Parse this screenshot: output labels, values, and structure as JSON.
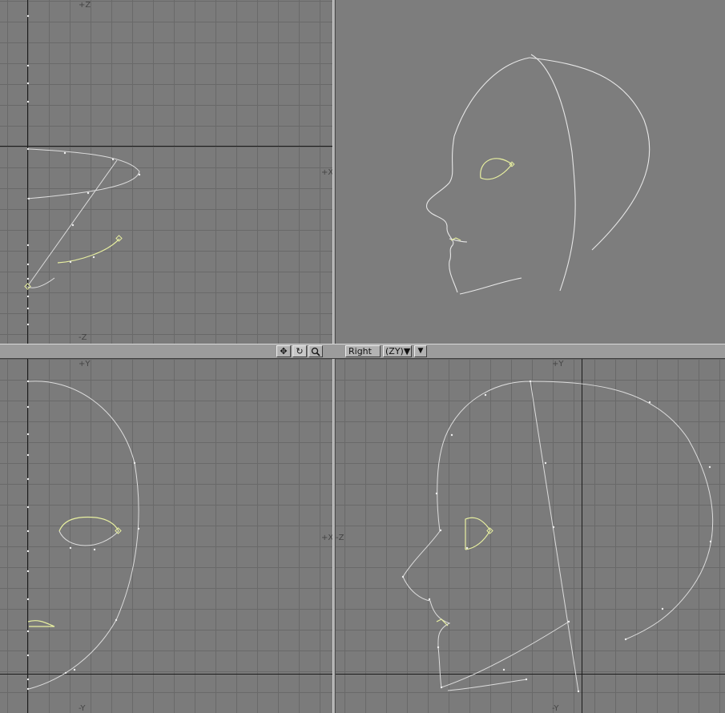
{
  "colors": {
    "curve": "#d8d8d8",
    "selected": "#e8f0a0",
    "viewport_bg": "#7b7b7b",
    "grid": "#696969",
    "axis": "#1c1c1c"
  },
  "viewports": {
    "top_left": {
      "label_top": "+Z",
      "label_right": "+X",
      "label_bottom": "-Z"
    },
    "top_right": {
      "mode": "perspective"
    },
    "bottom_left": {
      "label_top": "+Y",
      "label_right": "+X",
      "label_bottom": "-Y"
    },
    "bottom_right": {
      "label_top": "+Y",
      "label_left": "-Z",
      "label_bottom": "-Y"
    }
  },
  "toolbar": {
    "move_icon": "move-icon",
    "rotate_icon": "rotate-icon",
    "zoom_icon": "magnifier-icon",
    "view_name": "Right",
    "view_mode": "(ZY)▼",
    "dropdown_arrow": "▼"
  }
}
